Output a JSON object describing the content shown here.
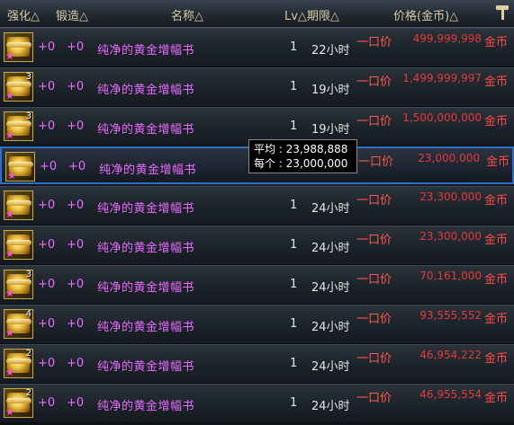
{
  "header": {
    "enhance": "强化△",
    "forge": "锻造△",
    "name": "名称△",
    "lv_limit": "Lv△期限△",
    "price": "价格(金币)△"
  },
  "rows": [
    {
      "qty": "",
      "enhance": "+0",
      "forge": "+0",
      "name": "纯净的黄金增幅书",
      "lv": "1",
      "limit": "22小时",
      "type": "一口价",
      "price": "499,999,998",
      "currency": "金币"
    },
    {
      "qty": "3",
      "enhance": "+0",
      "forge": "+0",
      "name": "纯净的黄金增幅书",
      "lv": "1",
      "limit": "19小时",
      "type": "一口价",
      "price": "1,499,999,997",
      "currency": "金币"
    },
    {
      "qty": "3",
      "enhance": "+0",
      "forge": "+0",
      "name": "纯净的黄金增幅书",
      "lv": "1",
      "limit": "19小时",
      "type": "一口价",
      "price": "1,500,000,000",
      "currency": "金币"
    },
    {
      "qty": "",
      "enhance": "+0",
      "forge": "+0",
      "name": "纯净的黄金增幅书",
      "lv": "",
      "limit": "",
      "type": "一口价",
      "price": "23,000,000",
      "currency": "金币"
    },
    {
      "qty": "",
      "enhance": "+0",
      "forge": "+0",
      "name": "纯净的黄金增幅书",
      "lv": "1",
      "limit": "24小时",
      "type": "一口价",
      "price": "23,300,000",
      "currency": "金币"
    },
    {
      "qty": "",
      "enhance": "+0",
      "forge": "+0",
      "name": "纯净的黄金增幅书",
      "lv": "1",
      "limit": "24小时",
      "type": "一口价",
      "price": "23,300,000",
      "currency": "金币"
    },
    {
      "qty": "3",
      "enhance": "+0",
      "forge": "+0",
      "name": "纯净的黄金增幅书",
      "lv": "1",
      "limit": "24小时",
      "type": "一口价",
      "price": "70,161,000",
      "currency": "金币"
    },
    {
      "qty": "4",
      "enhance": "+0",
      "forge": "+0",
      "name": "纯净的黄金增幅书",
      "lv": "1",
      "limit": "24小时",
      "type": "一口价",
      "price": "93,555,552",
      "currency": "金币"
    },
    {
      "qty": "2",
      "enhance": "+0",
      "forge": "+0",
      "name": "纯净的黄金增幅书",
      "lv": "1",
      "limit": "24小时",
      "type": "一口价",
      "price": "46,954,222",
      "currency": "金币"
    },
    {
      "qty": "2",
      "enhance": "+0",
      "forge": "+0",
      "name": "纯净的黄金增幅书",
      "lv": "1",
      "limit": "24小时",
      "type": "一口价",
      "price": "46,955,554",
      "currency": "金币"
    }
  ],
  "tooltip": {
    "average": "平均 : 23,988,888",
    "each": "每个 : 23,000,000"
  },
  "colors": {
    "name": "#e86cff",
    "price": "#e23b3b",
    "selected_border": "#2f6fc8"
  },
  "icons": {
    "item": "golden-scroll-icon",
    "rarity": "star-icon",
    "sort": "hammer-icon"
  },
  "selected_row": 3
}
